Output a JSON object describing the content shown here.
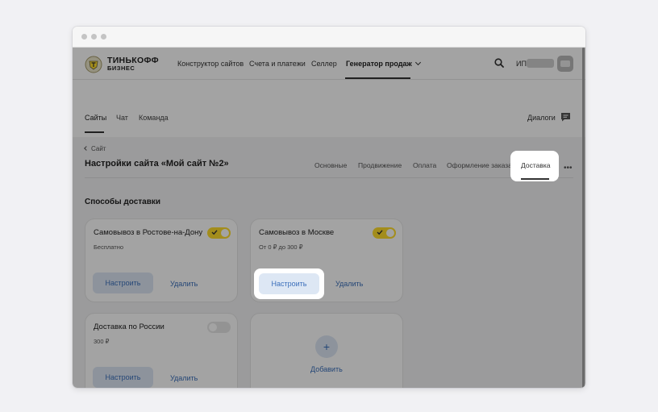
{
  "brand": {
    "name": "ТИНЬКОФФ",
    "sub": "БИЗНЕС"
  },
  "top_nav": [
    {
      "label": "Конструктор сайтов"
    },
    {
      "label": "Счета и платежи"
    },
    {
      "label": "Селлер"
    },
    {
      "label": "Генератор продаж",
      "active": true
    }
  ],
  "account": {
    "label": "ИП"
  },
  "sub_nav": [
    {
      "label": "Сайты",
      "active": true
    },
    {
      "label": "Чат"
    },
    {
      "label": "Команда"
    }
  ],
  "dialogs_label": "Диалоги",
  "breadcrumb": "Сайт",
  "page_title": "Настройки сайта «Мой сайт №2»",
  "settings_tabs": [
    {
      "label": "Основные"
    },
    {
      "label": "Продвижение"
    },
    {
      "label": "Оплата"
    },
    {
      "label": "Оформление заказа"
    },
    {
      "label": "Доставка",
      "active": true
    }
  ],
  "section_title": "Способы доставки",
  "delivery_methods": [
    {
      "title": "Самовывоз в Ростове-на-Дону",
      "price": "Бесплатно",
      "enabled": true,
      "setup_label": "Настроить",
      "delete_label": "Удалить"
    },
    {
      "title": "Самовывоз в Москве",
      "price": "От 0 ₽ до 300 ₽",
      "enabled": true,
      "setup_label": "Настроить",
      "delete_label": "Удалить"
    },
    {
      "title": "Доставка по России",
      "price": "300 ₽",
      "enabled": false,
      "setup_label": "Настроить",
      "delete_label": "Удалить"
    }
  ],
  "add_card": {
    "icon": "+",
    "label": "Добавить"
  },
  "colors": {
    "accent_yellow": "#ffdd2d",
    "link_blue": "#3b6fba",
    "button_bg": "#dde7f4"
  }
}
